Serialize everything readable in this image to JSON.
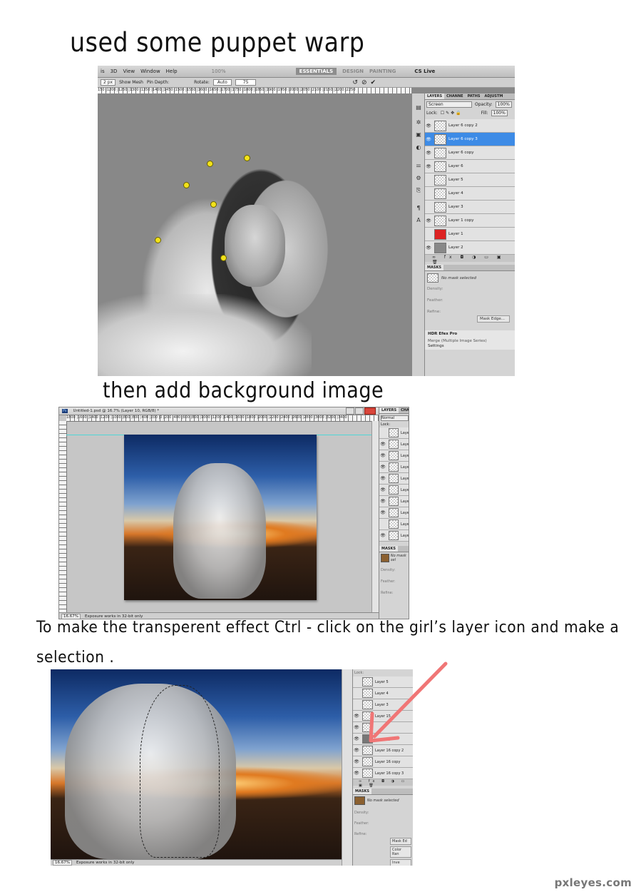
{
  "captions": {
    "step1": "used some puppet warp",
    "step2": "then add background image",
    "step3_line1": "To make the transperent effect  Ctrl - click on the girl’s layer icon and make a",
    "step3_line2": "selection ."
  },
  "shot1": {
    "menu": [
      "is",
      "3D",
      "View",
      "Window",
      "Help"
    ],
    "zoom": "100%",
    "workspace": [
      "ESSENTIALS",
      "DESIGN",
      "PAINTING"
    ],
    "cs_live": "CS Live",
    "options": {
      "expansion": "2 px",
      "show_mesh": "Show Mesh",
      "pin_depth": "Pin Depth:",
      "rotate": "Rotate:",
      "rotate_mode": "Auto",
      "rotate_value": "75"
    },
    "ruler": "150 |1200 |1250 |1300 |1350 |1400 |1450 |1500 |1550 |1600 |1650 |1700 |1750 |1800 |1850 |1900 |1950 |2000 |2050 |2100 |2150 |2200 |2250",
    "layers_tabs": [
      "LAYERS",
      "CHANNE",
      "PATHS",
      "ADJUSTM"
    ],
    "blend_mode": "Screen",
    "opacity_label": "Opacity:",
    "opacity": "100%",
    "lock_label": "Lock:",
    "fill_label": "Fill:",
    "fill": "100%",
    "layers": [
      "Layer 6 copy 2",
      "Layer 6 copy 3",
      "Layer 6 copy",
      "Layer 6",
      "Layer 5",
      "Layer 4",
      "Layer 3",
      "Layer 1 copy",
      "Layer 1",
      "Layer 2"
    ],
    "masks_title": "MASKS",
    "no_mask": "No mask selected",
    "density": "Density:",
    "feather": "Feather:",
    "refine": "Refine:",
    "mask_edge": "Mask Edge...",
    "hdr_title": "HDR Efex Pro",
    "hdr_sub": "Merge (Multiple Image Series)",
    "settings": "Settings"
  },
  "shot2": {
    "title": "Untitled-1.psd @ 16.7% (Layer 10, RGB/8) *",
    "ruler": "1800 |1600 |1400 |1200 |1000 |800 |600 |400 |200 |0 |200 |400 |600 |800 |1000 |1200 |1400 |1600 |1800 |2000 |2200 |2400 |2600 |2800 |3000 |3200 |3400",
    "panel_tabs": [
      "LAYERS",
      "CHANNE"
    ],
    "blend_mode": "Normal",
    "lock_label": "Lock:",
    "layers": [
      "Laye",
      "Laye",
      "Laye",
      "Laye",
      "Laye",
      "Laye",
      "Laye",
      "Laye",
      "Laye",
      "Laye"
    ],
    "masks_title": "MASKS",
    "no_mask": "No mask sel",
    "density": "Density:",
    "feather": "Feather:",
    "refine": "Refine:",
    "zoom": "16.67%",
    "status": "Exposure works in 32-bit only"
  },
  "shot3": {
    "lock_label": "Lock:",
    "layers": [
      "Layer 5",
      "Layer 4",
      "Layer 3",
      "Layer 15",
      "",
      "copy 3",
      "Layer 16 copy 2",
      "Layer 16 copy",
      "Layer 16 copy 3"
    ],
    "masks_title": "MASKS",
    "no_mask": "No mask selected",
    "density": "Density:",
    "feather": "Feather:",
    "refine": "Refine:",
    "btns": [
      "Mask Ed",
      "Color Ran",
      "Inve"
    ],
    "zoom": "16.67%",
    "status": "Exposure works in 32-bit only"
  },
  "watermark": "pxleyes.com",
  "colors": {
    "arrow": "#f07676",
    "selected_layer": "#3d8be6",
    "pin": "#f2e21a"
  }
}
